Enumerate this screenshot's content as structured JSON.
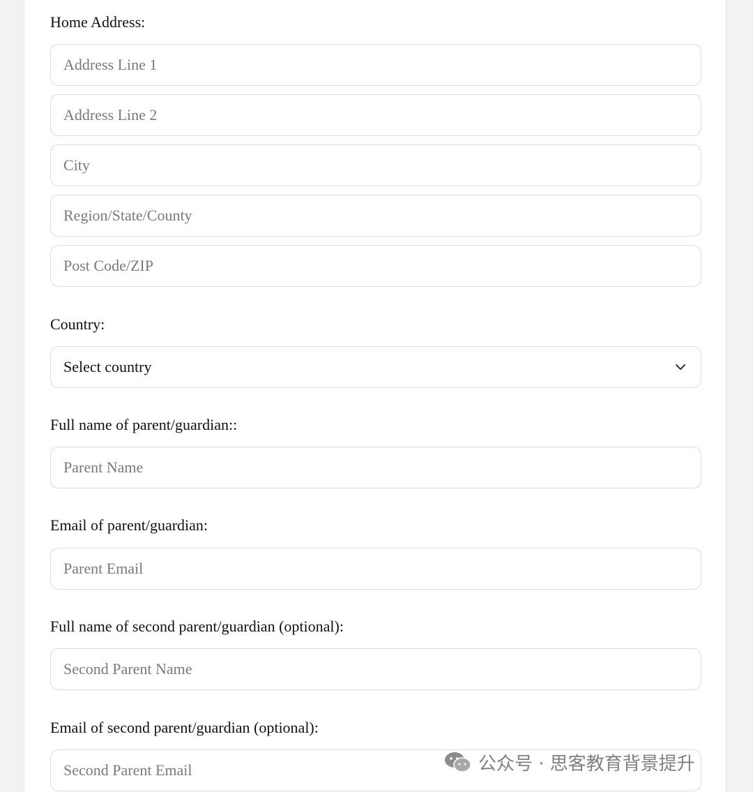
{
  "form": {
    "home_address_label": "Home Address:",
    "address_line1_placeholder": "Address Line 1",
    "address_line2_placeholder": "Address Line 2",
    "city_placeholder": "City",
    "region_placeholder": "Region/State/County",
    "postcode_placeholder": "Post Code/ZIP",
    "country_label": "Country:",
    "country_select_value": "Select country",
    "parent_name_label": "Full name of parent/guardian::",
    "parent_name_placeholder": "Parent Name",
    "parent_email_label": "Email of parent/guardian:",
    "parent_email_placeholder": "Parent Email",
    "second_parent_name_label": "Full name of second parent/guardian (optional):",
    "second_parent_name_placeholder": "Second Parent Name",
    "second_parent_email_label": "Email of second parent/guardian (optional):",
    "second_parent_email_placeholder": "Second Parent Email"
  },
  "watermark": {
    "text": "公众号 · 思客教育背景提升",
    "icon": "wechat-icon"
  },
  "icons": {
    "select_chevron": "chevron-down-icon"
  }
}
